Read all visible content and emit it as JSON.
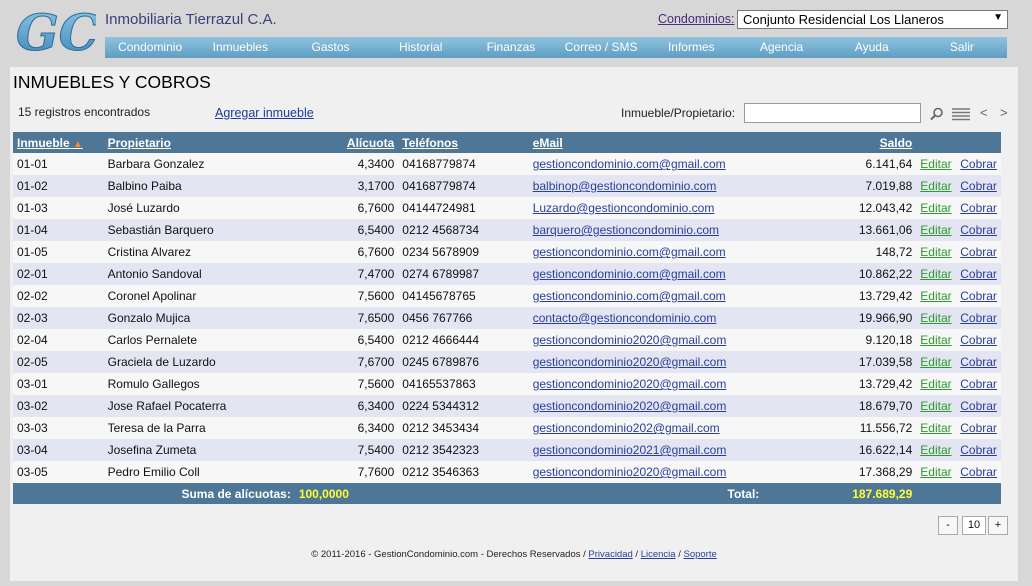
{
  "header": {
    "logo_text": "GC",
    "company": "Inmobiliaria Tierrazul C.A.",
    "condo_label": "Condominios:",
    "condo_selected": "Conjunto Residencial Los Llaneros"
  },
  "menu": [
    "Condominio",
    "Inmuebles",
    "Gastos",
    "Historial",
    "Finanzas",
    "Correo / SMS",
    "Informes",
    "Agencia",
    "Ayuda",
    "Salir"
  ],
  "page": {
    "title": "INMUEBLES Y COBROS",
    "count": "15 registros encontrados",
    "add_link": "Agregar inmueble",
    "search_label": "Inmueble/Propietario:",
    "search_value": ""
  },
  "table": {
    "headers": {
      "inmueble": "Inmueble",
      "propietario": "Propietario",
      "alicuota": "Alícuota",
      "telefonos": "Teléfonos",
      "email": "eMail",
      "saldo": "Saldo"
    },
    "edit_label": "Editar",
    "cobrar_label": "Cobrar",
    "rows": [
      {
        "inmueble": "01-01",
        "propietario": "Barbara Gonzalez",
        "alicuota": "4,3400",
        "telefono": "04168779874",
        "email": "gestioncondominio.com@gmail.com",
        "saldo": "6.141,64"
      },
      {
        "inmueble": "01-02",
        "propietario": "Balbino Paiba",
        "alicuota": "3,1700",
        "telefono": "04168779874",
        "email": "balbinop@gestioncondominio.com",
        "saldo": "7.019,88"
      },
      {
        "inmueble": "01-03",
        "propietario": "José Luzardo",
        "alicuota": "6,7600",
        "telefono": "04144724981",
        "email": "Luzardo@gestioncondominio.com",
        "saldo": "12.043,42"
      },
      {
        "inmueble": "01-04",
        "propietario": "Sebastián Barquero",
        "alicuota": "6,5400",
        "telefono": "0212 4568734",
        "email": "barquero@gestioncondominio.com",
        "saldo": "13.661,06"
      },
      {
        "inmueble": "01-05",
        "propietario": "Cristina Alvarez",
        "alicuota": "6,7600",
        "telefono": "0234 5678909",
        "email": "gestioncondominio.com@gmail.com",
        "saldo": "148,72"
      },
      {
        "inmueble": "02-01",
        "propietario": "Antonio Sandoval",
        "alicuota": "7,4700",
        "telefono": "0274 6789987",
        "email": "gestioncondominio.com@gmail.com",
        "saldo": "10.862,22"
      },
      {
        "inmueble": "02-02",
        "propietario": "Coronel Apolinar",
        "alicuota": "7,5600",
        "telefono": "04145678765",
        "email": "gestioncondominio.com@gmail.com",
        "saldo": "13.729,42"
      },
      {
        "inmueble": "02-03",
        "propietario": "Gonzalo Mujica",
        "alicuota": "7,6500",
        "telefono": "0456 767766",
        "email": "contacto@gestioncondominio.com",
        "saldo": "19.966,90"
      },
      {
        "inmueble": "02-04",
        "propietario": "Carlos Pernalete",
        "alicuota": "6,5400",
        "telefono": "0212 4666444",
        "email": "gestioncondominio2020@gmail.com",
        "saldo": "9.120,18"
      },
      {
        "inmueble": "02-05",
        "propietario": "Graciela de Luzardo",
        "alicuota": "7,6700",
        "telefono": "0245 6789876",
        "email": "gestioncondominio2020@gmail.com",
        "saldo": "17.039,58"
      },
      {
        "inmueble": "03-01",
        "propietario": "Romulo Gallegos",
        "alicuota": "7,5600",
        "telefono": "04165537863",
        "email": "gestioncondominio2020@gmail.com",
        "saldo": "13.729,42"
      },
      {
        "inmueble": "03-02",
        "propietario": "Jose Rafael Pocaterra",
        "alicuota": "6,3400",
        "telefono": "0224 5344312",
        "email": "gestioncondominio2020@gmail.com",
        "saldo": "18.679,70"
      },
      {
        "inmueble": "03-03",
        "propietario": "Teresa de la Parra",
        "alicuota": "6,3400",
        "telefono": "0212 3453434",
        "email": "gestioncondominio202@gmail.com",
        "saldo": "11.556,72"
      },
      {
        "inmueble": "03-04",
        "propietario": "Josefina Zumeta",
        "alicuota": "7,5400",
        "telefono": "0212 3542323",
        "email": "gestioncondominio2021@gmail.com",
        "saldo": "16.622,14"
      },
      {
        "inmueble": "03-05",
        "propietario": "Pedro Emilio Coll",
        "alicuota": "7,7600",
        "telefono": "0212 3546363",
        "email": "gestioncondominio2020@gmail.com",
        "saldo": "17.368,29"
      }
    ],
    "footer": {
      "sum_label": "Suma de alícuotas:",
      "sum_value": "100,0000",
      "total_label": "Total:",
      "total_value": "187.689,29"
    }
  },
  "pager": {
    "minus": "-",
    "page_size": "10",
    "plus": "+"
  },
  "footer": {
    "copyright": "© 2011-2016 - GestionCondominio.com - Derechos Reservados /",
    "privacidad": "Privacidad",
    "licencia": "Licencia",
    "soporte": "Soporte"
  },
  "colors": {
    "menubar": "#6fa9cb",
    "table_header": "#4e7696",
    "row_alt": "#e4e5f3",
    "link_green": "#2d9a2d",
    "total_yellow": "#ffff33"
  },
  "icons": [
    "search-icon",
    "list-icon",
    "prev-icon",
    "next-icon",
    "sort-asc-icon"
  ]
}
